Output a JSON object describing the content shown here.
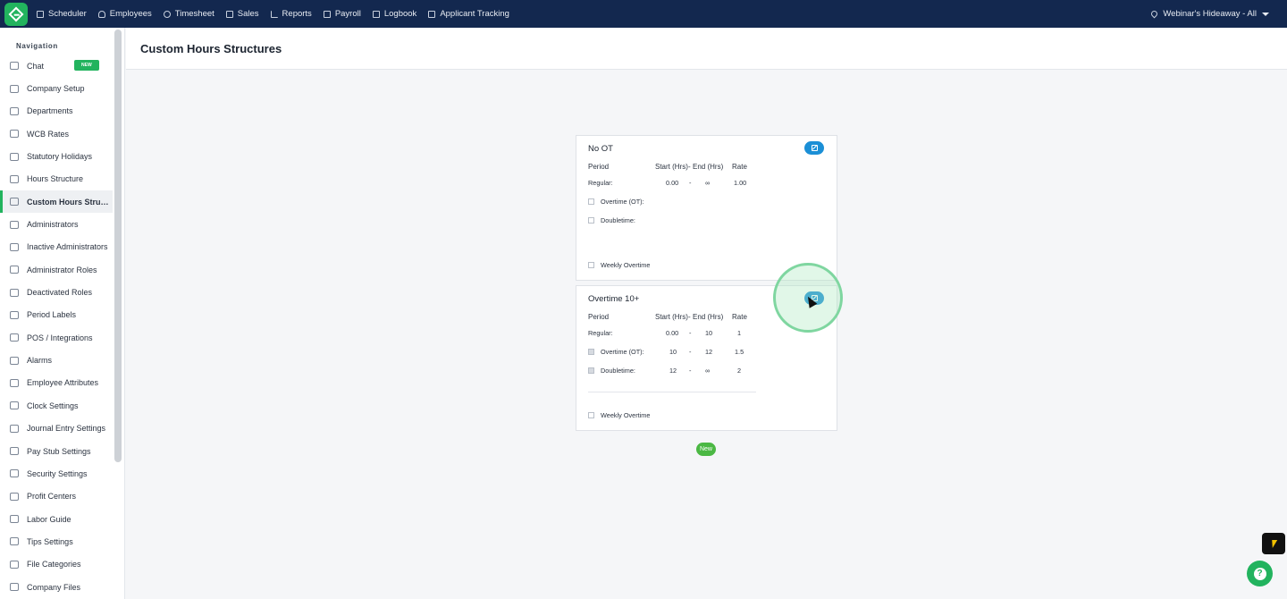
{
  "topbar": {
    "nav": [
      {
        "label": "Scheduler",
        "icon": "calendar-icon"
      },
      {
        "label": "Employees",
        "icon": "person-icon"
      },
      {
        "label": "Timesheet",
        "icon": "clock-icon"
      },
      {
        "label": "Sales",
        "icon": "sales-icon"
      },
      {
        "label": "Reports",
        "icon": "chart-icon"
      },
      {
        "label": "Payroll",
        "icon": "payroll-icon"
      },
      {
        "label": "Logbook",
        "icon": "book-icon"
      },
      {
        "label": "Applicant Tracking",
        "icon": "clipboard-icon"
      }
    ],
    "location": "Webinar's Hideaway - All"
  },
  "sidebar": {
    "title": "Navigation",
    "badge": "NEW",
    "items": [
      {
        "label": "Chat"
      },
      {
        "label": "Company Setup"
      },
      {
        "label": "Departments"
      },
      {
        "label": "WCB Rates"
      },
      {
        "label": "Statutory Holidays"
      },
      {
        "label": "Hours Structure"
      },
      {
        "label": "Custom Hours Structu..."
      },
      {
        "label": "Administrators"
      },
      {
        "label": "Inactive Administrators"
      },
      {
        "label": "Administrator Roles"
      },
      {
        "label": "Deactivated Roles"
      },
      {
        "label": "Period Labels"
      },
      {
        "label": "POS / Integrations"
      },
      {
        "label": "Alarms"
      },
      {
        "label": "Employee Attributes"
      },
      {
        "label": "Clock Settings"
      },
      {
        "label": "Journal Entry Settings"
      },
      {
        "label": "Pay Stub Settings"
      },
      {
        "label": "Security Settings"
      },
      {
        "label": "Profit Centers"
      },
      {
        "label": "Labor Guide"
      },
      {
        "label": "Tips Settings"
      },
      {
        "label": "File Categories"
      },
      {
        "label": "Company Files"
      }
    ]
  },
  "page": {
    "title": "Custom Hours Structures"
  },
  "columns": {
    "period": "Period",
    "start": "Start (Hrs)",
    "sep": "-",
    "end": "End (Hrs)",
    "rate": "Rate"
  },
  "cards": [
    {
      "title": "No OT",
      "rows": {
        "regular": {
          "label": "Regular:",
          "start": "0.00",
          "sep": "-",
          "end": "∞",
          "rate": "1.00"
        },
        "overtime": {
          "label": "Overtime (OT):",
          "start": "",
          "sep": "",
          "end": "",
          "rate": ""
        },
        "doubletime": {
          "label": "Doubletime:",
          "start": "",
          "sep": "",
          "end": "",
          "rate": ""
        }
      },
      "weekly": "Weekly Overtime"
    },
    {
      "title": "Overtime 10+",
      "rows": {
        "regular": {
          "label": "Regular:",
          "start": "0.00",
          "sep": "-",
          "end": "10",
          "rate": "1"
        },
        "overtime": {
          "label": "Overtime (OT):",
          "start": "10",
          "sep": "-",
          "end": "12",
          "rate": "1.5"
        },
        "doubletime": {
          "label": "Doubletime:",
          "start": "12",
          "sep": "-",
          "end": "∞",
          "rate": "2"
        }
      },
      "weekly": "Weekly Overtime"
    }
  ],
  "new_button": "New",
  "help": "?"
}
